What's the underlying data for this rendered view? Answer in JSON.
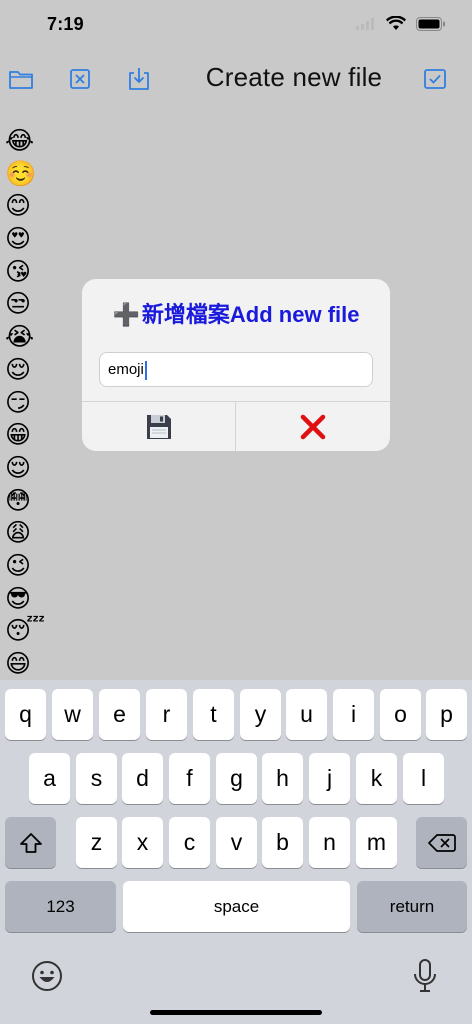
{
  "status": {
    "time": "7:19"
  },
  "toolbar": {
    "title": "Create new file",
    "icons": [
      "folder-icon",
      "close-box-icon",
      "download-tray-icon",
      "checkbox-icon"
    ]
  },
  "emojis": [
    "😂",
    "☺️",
    "😊",
    "😍",
    "😘",
    "😒",
    "😭",
    "😌",
    "😏",
    "😁",
    "😌",
    "😳",
    "😩",
    "😉",
    "😎",
    "😴",
    "😄"
  ],
  "dialog": {
    "title": "新增檔案Add new file",
    "plus": "➕",
    "input_value": "emoji",
    "save_icon": "floppy-disk-icon",
    "cancel_icon": "red-cross-icon"
  },
  "keyboard": {
    "row1": [
      "q",
      "w",
      "e",
      "r",
      "t",
      "y",
      "u",
      "i",
      "o",
      "p"
    ],
    "row2": [
      "a",
      "s",
      "d",
      "f",
      "g",
      "h",
      "j",
      "k",
      "l"
    ],
    "row3": [
      "z",
      "x",
      "c",
      "v",
      "b",
      "n",
      "m"
    ],
    "numbers": "123",
    "space": "space",
    "return": "return"
  },
  "colors": {
    "accent": "#2f7fe0",
    "dialog_title": "#1a1adc",
    "cancel": "#e01010"
  }
}
